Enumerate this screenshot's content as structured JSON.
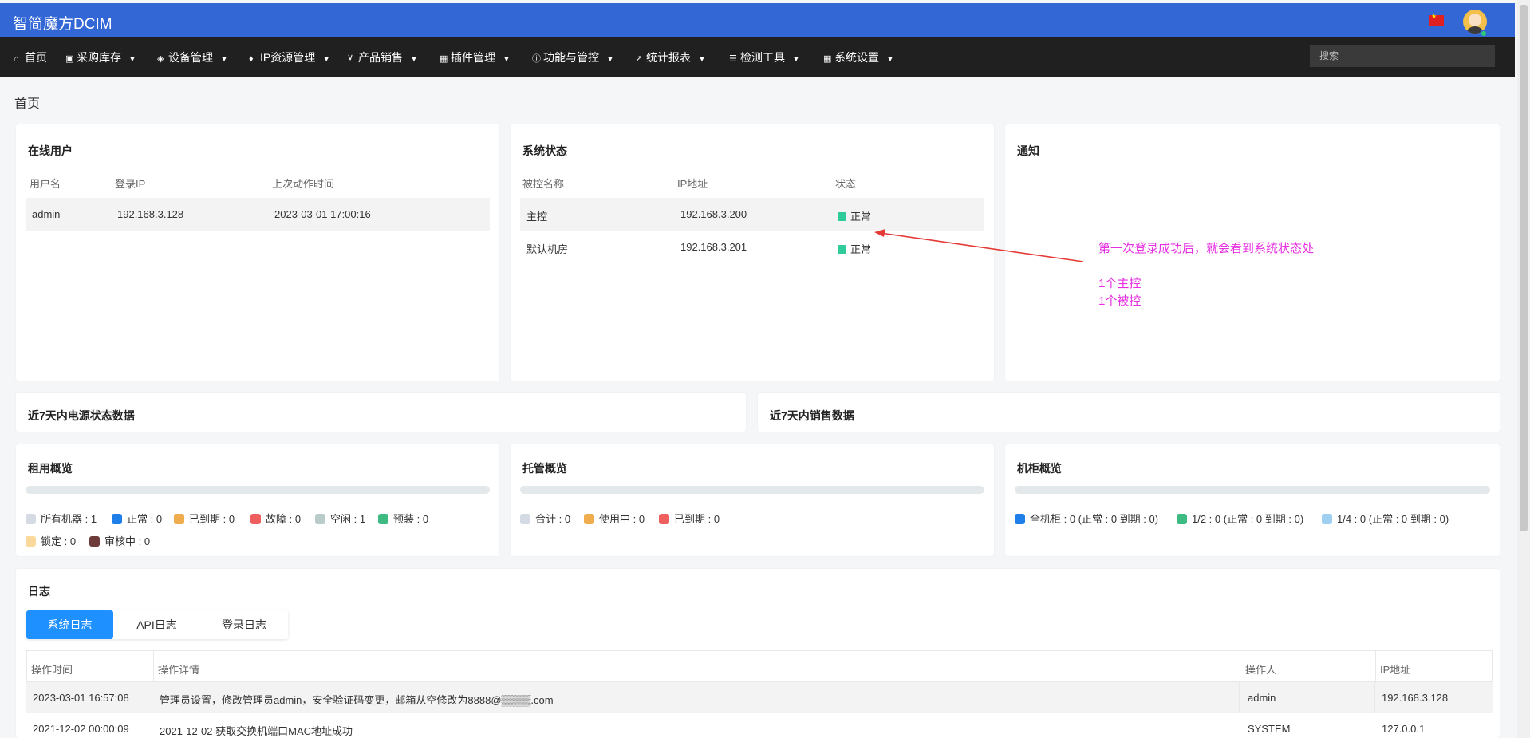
{
  "app": {
    "title": "智简魔方DCIM"
  },
  "nav": {
    "items": [
      {
        "icon": "home-icon",
        "glyph": "⌂",
        "label": "首页",
        "dropdown": false
      },
      {
        "icon": "box-icon",
        "glyph": "▣",
        "label": "采购库存",
        "dropdown": true
      },
      {
        "icon": "cube-icon",
        "glyph": "◈",
        "label": "设备管理",
        "dropdown": true
      },
      {
        "icon": "map-marker-icon",
        "glyph": "♦",
        "label": "IP资源管理",
        "dropdown": true
      },
      {
        "icon": "cart-icon",
        "glyph": "⊻",
        "label": "产品销售",
        "dropdown": true
      },
      {
        "icon": "grid-icon",
        "glyph": "▦",
        "label": "插件管理",
        "dropdown": true
      },
      {
        "icon": "info-icon",
        "glyph": "ⓘ",
        "label": "功能与管控",
        "dropdown": true
      },
      {
        "icon": "line-chart-icon",
        "glyph": "↗",
        "label": "统计报表",
        "dropdown": true
      },
      {
        "icon": "list-icon",
        "glyph": "☰",
        "label": "检测工具",
        "dropdown": true
      },
      {
        "icon": "apps-icon",
        "glyph": "▦",
        "label": "系统设置",
        "dropdown": true
      }
    ],
    "search_placeholder": "搜索"
  },
  "page": {
    "title": "首页"
  },
  "online_users": {
    "title": "在线用户",
    "headers": [
      "用户名",
      "登录IP",
      "上次动作时间"
    ],
    "rows": [
      [
        "admin",
        "192.168.3.128",
        "2023-03-01 17:00:16"
      ]
    ]
  },
  "system_status": {
    "title": "系统状态",
    "headers": [
      "被控名称",
      "IP地址",
      "状态"
    ],
    "rows": [
      [
        "主控",
        "192.168.3.200",
        "正常"
      ],
      [
        "默认机房",
        "192.168.3.201",
        "正常"
      ]
    ],
    "status_color": "#2ecc9a"
  },
  "notice": {
    "title": "通知"
  },
  "annotation": {
    "line1": "第一次登录成功后，就会看到系统状态处",
    "line2": "1个主控",
    "line3": "1个被控",
    "color": "#e52fe0",
    "arrow_color": "#e53935"
  },
  "power_card": {
    "title": "近7天内电源状态数据"
  },
  "sales_card": {
    "title": "近7天内销售数据"
  },
  "rental": {
    "title": "租用概览",
    "legend": [
      {
        "label": "所有机器 : 1",
        "color": "#d5dbe4"
      },
      {
        "label": "正常 : 0",
        "color": "#1e7fe8"
      },
      {
        "label": "已到期 : 0",
        "color": "#f0ad4e"
      },
      {
        "label": "故障 : 0",
        "color": "#ef5f5f"
      },
      {
        "label": "空闲 : 1",
        "color": "#b9ccc9"
      },
      {
        "label": "预装 : 0",
        "color": "#3dbb82"
      },
      {
        "label": "锁定 : 0",
        "color": "#fbd89b"
      },
      {
        "label": "审核中 : 0",
        "color": "#6e3b3b"
      }
    ]
  },
  "hosting": {
    "title": "托管概览",
    "legend": [
      {
        "label": "合计 : 0",
        "color": "#d5dbe4"
      },
      {
        "label": "使用中 : 0",
        "color": "#f0ad4e"
      },
      {
        "label": "已到期 : 0",
        "color": "#ef5f5f"
      }
    ]
  },
  "cabinet": {
    "title": "机柜概览",
    "legend": [
      {
        "label": "全机柜 : 0 (正常 : 0 到期 : 0)",
        "color": "#1e7fe8"
      },
      {
        "label": "1/2 : 0 (正常 : 0 到期 : 0)",
        "color": "#3dbb82"
      },
      {
        "label": "1/4 : 0 (正常 : 0 到期 : 0)",
        "color": "#9fd0f2"
      }
    ]
  },
  "logs": {
    "title": "日志",
    "tabs": [
      "系统日志",
      "API日志",
      "登录日志"
    ],
    "active_tab": "系统日志",
    "headers": [
      "操作时间",
      "操作详情",
      "操作人",
      "IP地址"
    ],
    "rows": [
      [
        "2023-03-01 16:57:08",
        "管理员设置，修改管理员admin，安全验证码变更，邮箱从空修改为8888@▒▒▒▒.com",
        "admin",
        "192.168.3.128"
      ],
      [
        "2021-12-02 00:00:09",
        "2021-12-02 获取交换机端口MAC地址成功",
        "SYSTEM",
        "127.0.0.1"
      ]
    ]
  },
  "theme": {
    "topbar": "#3367d6",
    "navbar": "#202020",
    "accent": "#1e90ff"
  }
}
